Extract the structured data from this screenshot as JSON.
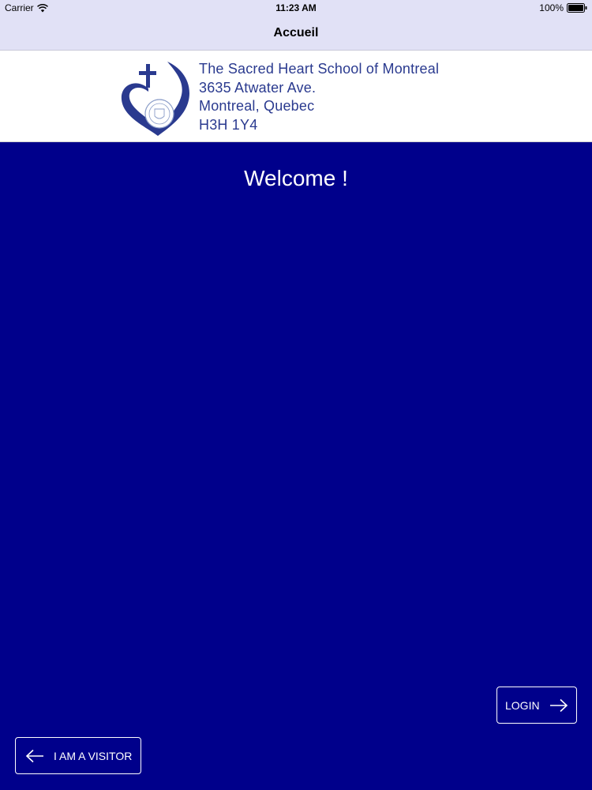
{
  "status_bar": {
    "carrier": "Carrier",
    "time": "11:23 AM",
    "battery": "100%"
  },
  "nav": {
    "title": "Accueil"
  },
  "header": {
    "lines": [
      "The Sacred Heart School of Montreal",
      "3635 Atwater Ave.",
      "Montreal, Quebec",
      "H3H 1Y4"
    ],
    "logo_icon": "heart-cross-logo-icon"
  },
  "main": {
    "welcome": "Welcome !"
  },
  "buttons": {
    "login_label": "LOGIN",
    "visitor_label": "I AM A VISITOR",
    "login_icon": "arrow-right-icon",
    "visitor_icon": "arrow-left-icon"
  },
  "colors": {
    "background": "#00008b",
    "bar": "#e1e1f6",
    "text_blue": "#2a3a8f",
    "white": "#ffffff"
  }
}
